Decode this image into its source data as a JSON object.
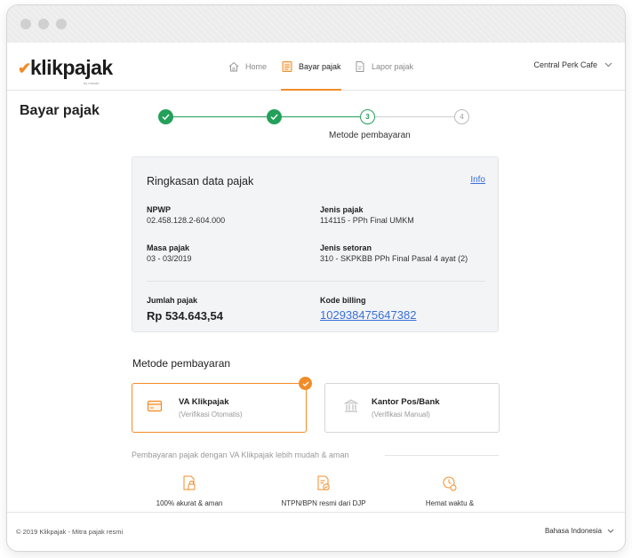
{
  "brand": {
    "logo_text": "klikpajak",
    "logo_sub": "by mekari",
    "accent_color": "#f28c28",
    "success_color": "#23a05a",
    "link_color": "#3a6fd8"
  },
  "nav": {
    "items": [
      {
        "label": "Home",
        "icon": "home-icon"
      },
      {
        "label": "Bayar pajak",
        "icon": "bill-icon",
        "active": true
      },
      {
        "label": "Lapor pajak",
        "icon": "report-icon"
      }
    ],
    "company": "Central Perk Cafe"
  },
  "page": {
    "title": "Bayar pajak"
  },
  "stepper": {
    "steps": [
      "done",
      "done",
      "3",
      "4"
    ],
    "current_label": "Metode pembayaran"
  },
  "summary": {
    "title": "Ringkasan data pajak",
    "info_link": "Info",
    "npwp_label": "NPWP",
    "npwp_value": "02.458.128.2-604.000",
    "jenis_pajak_label": "Jenis pajak",
    "jenis_pajak_value": "114115 - PPh Final UMKM",
    "masa_pajak_label": "Masa pajak",
    "masa_pajak_value": "03 - 03/2019",
    "jenis_setoran_label": "Jenis setoran",
    "jenis_setoran_value": "310 - SKPKBB PPh Final Pasal 4 ayat (2)",
    "jumlah_label": "Jumlah pajak",
    "jumlah_value": "Rp 534.643,54",
    "billing_label": "Kode billing",
    "billing_value": "102938475647382"
  },
  "method": {
    "title": "Metode pembayaran",
    "options": [
      {
        "name": "VA Klikpajak",
        "desc": "(Verifikasi Otomatis)",
        "icon": "card-icon",
        "selected": true
      },
      {
        "name": "Kantor Pos/Bank",
        "desc": "(Verifikasi Manual)",
        "icon": "bank-icon",
        "selected": false
      }
    ],
    "promo": "Pembayaran pajak dengan VA Klikpajak lebih mudah & aman",
    "features": [
      {
        "label": "100% akurat & aman",
        "icon": "secure-doc-icon"
      },
      {
        "label": "NTPN/BPN resmi dari DJP",
        "icon": "official-doc-icon"
      },
      {
        "label": "Hemat waktu &",
        "icon": "time-save-icon"
      }
    ]
  },
  "footer": {
    "copyright": "© 2019 Klikpajak - Mitra pajak resmi",
    "language": "Bahasa Indonesia"
  }
}
